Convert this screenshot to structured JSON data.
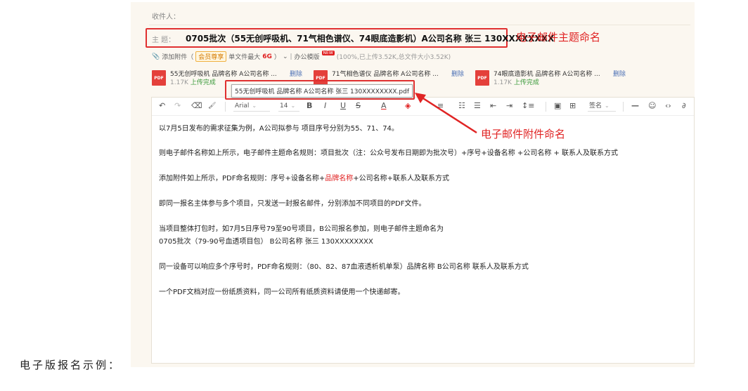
{
  "email": {
    "recipient_label": "收件人：",
    "subject_label": "主 题：",
    "subject_value": "0705批次（55无创呼吸机、71气相色谱仪、74眼底造影机）A公司名称 张三 130XXXXXXXX",
    "attach_bar": {
      "add_attachment": "添加附件（",
      "vip_badge": "会员尊享",
      "single_file_max": "单文件最大",
      "max_size": "6G",
      "close_paren": "）",
      "chevron": "⌄",
      "divider": "|",
      "office_template": "办公模版",
      "new_badge": "NEW",
      "upload_status": "(100%,已上传3.52K,总文件大小3.52K)"
    },
    "attachments": [
      {
        "icon_label": "PDF",
        "name": "55无创呼吸机 品牌名称 A公司名称 ...",
        "delete_label": "删除",
        "size": "1.17K",
        "status": "上传完成"
      },
      {
        "icon_label": "PDF",
        "name": "71气相色谱仪 品牌名称 A公司名称 ...",
        "delete_label": "删除",
        "size": "",
        "status": ""
      },
      {
        "icon_label": "PDF",
        "name": "74眼底造影机 品牌名称 A公司名称 ...",
        "delete_label": "删除",
        "size": "1.17K",
        "status": "上传完成"
      }
    ],
    "tooltip": "55无创呼吸机 品牌名称 A公司名称 张三 130XXXXXXXX.pdf"
  },
  "annotations": {
    "subject": "电子邮件主题命名",
    "attachment": "电子邮件附件命名",
    "color": "#e02424"
  },
  "toolbar": {
    "undo": "↶",
    "redo": "↷",
    "eraser": "⌫",
    "format_painter": "🖌",
    "font_family": "Arial",
    "font_size": "14",
    "dropdown_caret": "⌄",
    "bold": "B",
    "italic": "I",
    "underline": "U",
    "strikethrough": "S",
    "font_color": "A",
    "highlight": "◈",
    "align": "≡",
    "ordered_list": "☷",
    "unordered_list": "☰",
    "outdent": "⇤",
    "indent": "⇥",
    "line_height": "↕≡",
    "image": "▣",
    "table": "⊞",
    "signature": "签名",
    "hr": "—",
    "emoji": "☺",
    "code": "‹›",
    "link": "∂"
  },
  "body": {
    "line1": "以7月5日发布的需求征集为例，A公司拟参与 项目序号分别为55、71、74。",
    "line2": "则电子邮件名称如上所示，电子邮件主题命名规则：项目批次（注：公众号发布日期即为批次号）+序号+设备名称 +公司名称 + 联系人及联系方式",
    "line3_a": "添加附件如上所示，PDF命名规则：序号+设备名称+",
    "line3_red": "品牌名称",
    "line3_b": "+公司名称+联系人及联系方式",
    "line4": "即同一报名主体参与多个项目，只发送一封报名邮件，分别添加不同项目的PDF文件。",
    "line5": "当项目整体打包时，如7月5日序号79至90号项目，B公司报名参加，则电子邮件主题命名为",
    "line6": "0705批次（79-90号血透项目包） B公司名称 张三  130XXXXXXXX",
    "line7": "同一设备可以响应多个序号时，PDF命名规则：（80、82、87血液透析机单泵）品牌名称 B公司名称 联系人及联系方式",
    "line8": "一个PDF文档对应一份纸质资料，同一公司所有纸质资料请使用一个快递邮寄。"
  },
  "caption": "电子版报名示例："
}
